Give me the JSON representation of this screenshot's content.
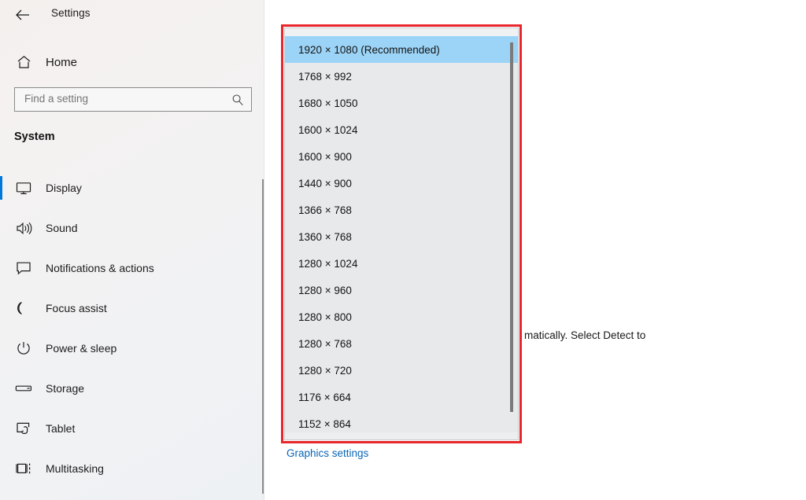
{
  "window": {
    "app_title": "Settings",
    "back_icon": "back-arrow-icon"
  },
  "sidebar": {
    "home": {
      "label": "Home",
      "icon": "home-icon"
    },
    "search": {
      "placeholder": "Find a setting",
      "value": "",
      "icon": "search-icon"
    },
    "section_title": "System",
    "items": [
      {
        "label": "Display",
        "icon": "monitor-icon",
        "selected": true
      },
      {
        "label": "Sound",
        "icon": "speaker-icon",
        "selected": false
      },
      {
        "label": "Notifications & actions",
        "icon": "chat-bubble-icon",
        "selected": false
      },
      {
        "label": "Focus assist",
        "icon": "moon-icon",
        "selected": false
      },
      {
        "label": "Power & sleep",
        "icon": "power-icon",
        "selected": false
      },
      {
        "label": "Storage",
        "icon": "drive-icon",
        "selected": false
      },
      {
        "label": "Tablet",
        "icon": "tablet-touch-icon",
        "selected": false
      },
      {
        "label": "Multitasking",
        "icon": "multitasking-icon",
        "selected": false
      }
    ]
  },
  "content": {
    "partial_description": "matically. Select Detect to",
    "graphics_link": "Graphics settings"
  },
  "resolution_dropdown": {
    "selected_value": "1920 × 1080 (Recommended)",
    "options": [
      {
        "label": "1920 × 1080 (Recommended)",
        "highlighted": true
      },
      {
        "label": "1768 × 992",
        "highlighted": false
      },
      {
        "label": "1680 × 1050",
        "highlighted": false
      },
      {
        "label": "1600 × 1024",
        "highlighted": false
      },
      {
        "label": "1600 × 900",
        "highlighted": false
      },
      {
        "label": "1440 × 900",
        "highlighted": false
      },
      {
        "label": "1366 × 768",
        "highlighted": false
      },
      {
        "label": "1360 × 768",
        "highlighted": false
      },
      {
        "label": "1280 × 1024",
        "highlighted": false
      },
      {
        "label": "1280 × 960",
        "highlighted": false
      },
      {
        "label": "1280 × 800",
        "highlighted": false
      },
      {
        "label": "1280 × 768",
        "highlighted": false
      },
      {
        "label": "1280 × 720",
        "highlighted": false
      },
      {
        "label": "1176 × 664",
        "highlighted": false
      },
      {
        "label": "1152 × 864",
        "highlighted": false
      }
    ]
  },
  "annotation": {
    "type": "red-rectangle-highlight",
    "color": "#e8262b"
  },
  "colors": {
    "accent_blue": "#0078d7",
    "highlight_blue": "#9cd4f7",
    "link_blue": "#0a65b5",
    "annotation_red": "#e8262b",
    "dropdown_bg": "#e7e9eb"
  }
}
